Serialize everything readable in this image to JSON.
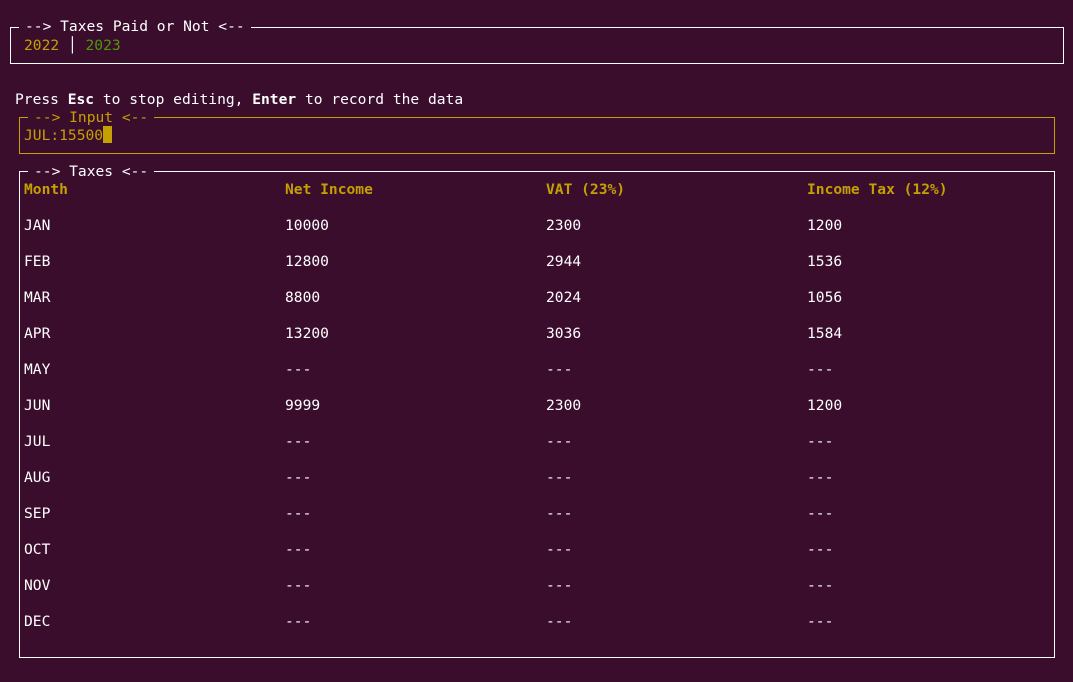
{
  "tabs_box": {
    "title": "--> Taxes Paid or Not <--",
    "tabs": [
      "2022",
      "2023"
    ],
    "colors": {
      "tab_2022": "#c4a000",
      "tab_2023": "#4e9a06"
    }
  },
  "hint": {
    "press": "Press ",
    "esc": "Esc",
    "middle": " to stop editing, ",
    "enter": "Enter",
    "end": " to record the data"
  },
  "input_box": {
    "title": "--> Input <--",
    "value": "JUL:15500"
  },
  "taxes_box": {
    "title": "--> Taxes <--",
    "columns": [
      "Month",
      "Net Income",
      "VAT (23%)",
      "Income Tax (12%)"
    ],
    "rows": [
      [
        "JAN",
        "10000",
        "2300",
        "1200"
      ],
      [
        "FEB",
        "12800",
        "2944",
        "1536"
      ],
      [
        "MAR",
        "8800",
        "2024",
        "1056"
      ],
      [
        "APR",
        "13200",
        "3036",
        "1584"
      ],
      [
        "MAY",
        "---",
        "---",
        "---"
      ],
      [
        "JUN",
        "9999",
        "2300",
        "1200"
      ],
      [
        "JUL",
        "---",
        "---",
        "---"
      ],
      [
        "AUG",
        "---",
        "---",
        "---"
      ],
      [
        "SEP",
        "---",
        "---",
        "---"
      ],
      [
        "OCT",
        "---",
        "---",
        "---"
      ],
      [
        "NOV",
        "---",
        "---",
        "---"
      ],
      [
        "DEC",
        "---",
        "---",
        "---"
      ]
    ]
  },
  "colors": {
    "background": "#3a0d2d",
    "accent": "#c4a000",
    "text": "#ffffff"
  }
}
